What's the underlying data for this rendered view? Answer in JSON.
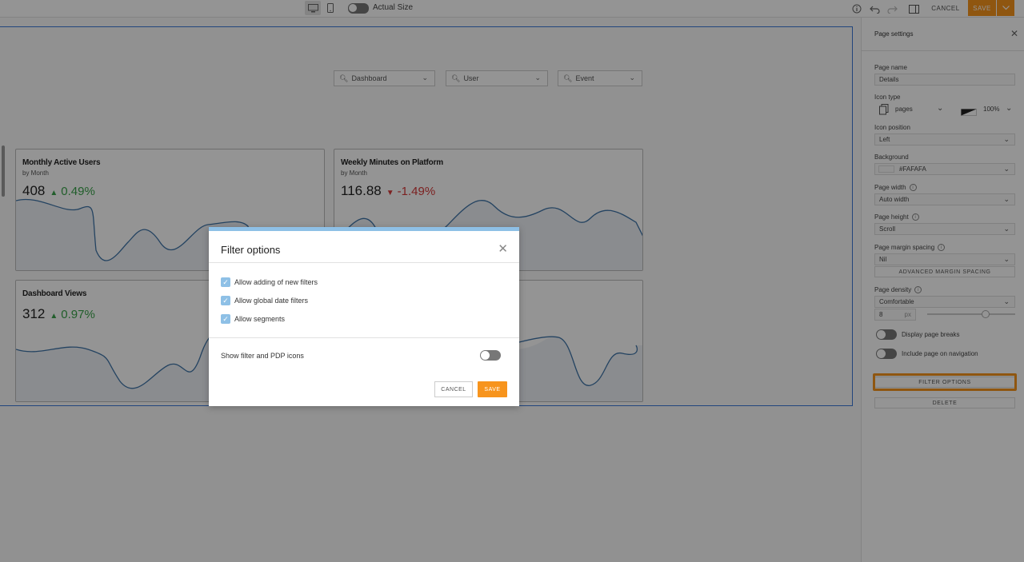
{
  "toolbar": {
    "actual_size_label": "Actual Size",
    "cancel_label": "CANCEL",
    "save_label": "SAVE"
  },
  "filters": [
    {
      "label": "Dashboard"
    },
    {
      "label": "User"
    },
    {
      "label": "Event"
    }
  ],
  "widgets": [
    {
      "title": "Monthly Active Users",
      "subtitle": "by Month",
      "value": "408",
      "delta": "0.49%",
      "direction": "up"
    },
    {
      "title": "Weekly Minutes on Platform",
      "subtitle": "by Month",
      "value": "116.88",
      "delta": "-1.49%",
      "direction": "down"
    },
    {
      "title": "Dashboard Views",
      "subtitle": "",
      "value": "312",
      "delta": "0.97%",
      "direction": "up"
    },
    {
      "title": "",
      "subtitle": "",
      "value": "",
      "delta": "",
      "direction": ""
    }
  ],
  "panel": {
    "title": "Page settings",
    "page_name_label": "Page name",
    "page_name_value": "Details",
    "icon_type_label": "Icon type",
    "icon_type_value": "pages",
    "icon_opacity": "100%",
    "icon_position_label": "Icon position",
    "icon_position_value": "Left",
    "background_label": "Background",
    "background_value": "#FAFAFA",
    "page_width_label": "Page width",
    "page_width_value": "Auto width",
    "page_height_label": "Page height",
    "page_height_value": "Scroll",
    "margin_label": "Page margin spacing",
    "margin_value": "Nil",
    "advanced_margin_label": "ADVANCED MARGIN SPACING",
    "density_label": "Page density",
    "density_value": "Comfortable",
    "density_px_value": "8",
    "density_px_unit": "px",
    "page_breaks_label": "Display page breaks",
    "include_nav_label": "Include page on navigation",
    "filter_options_label": "FILTER OPTIONS",
    "delete_label": "DELETE"
  },
  "modal": {
    "title": "Filter options",
    "options": [
      {
        "label": "Allow adding of new filters",
        "checked": true
      },
      {
        "label": "Allow global date filters",
        "checked": true
      },
      {
        "label": "Allow segments",
        "checked": true
      }
    ],
    "pdp_label": "Show filter and PDP icons",
    "cancel_label": "CANCEL",
    "save_label": "SAVE"
  },
  "colors": {
    "accent": "#f7941d",
    "selection": "#3a78d8",
    "checkbox": "#8ec0e6",
    "up": "#3aa34a",
    "down": "#d63a3a",
    "line": "#3f74a8"
  }
}
